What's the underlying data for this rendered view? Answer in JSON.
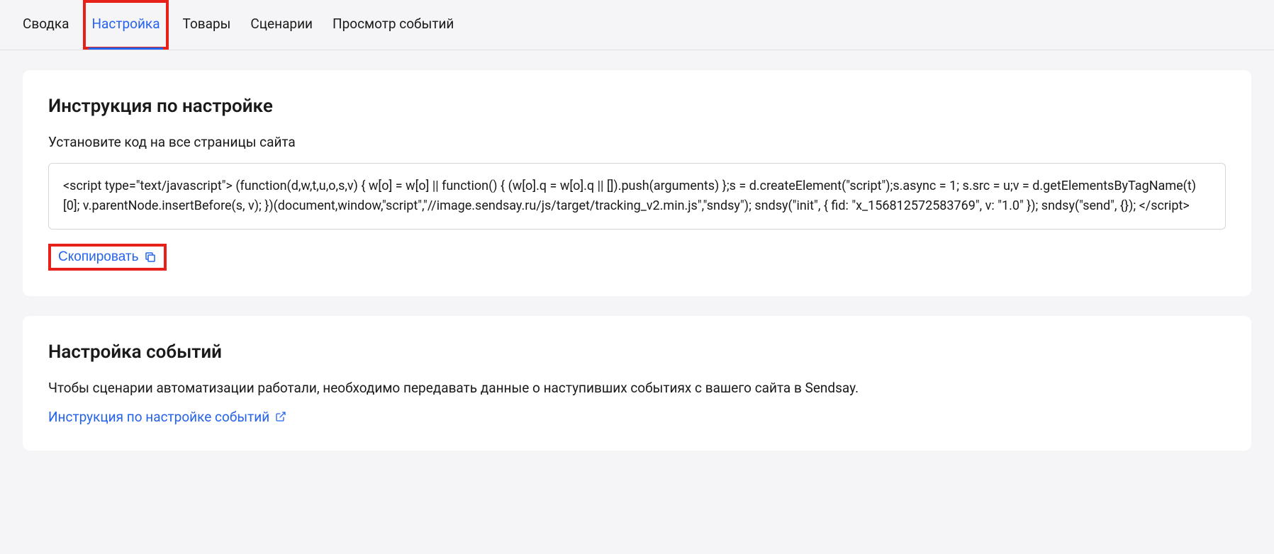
{
  "tabs": [
    {
      "label": "Сводка",
      "active": false
    },
    {
      "label": "Настройка",
      "active": true
    },
    {
      "label": "Товары",
      "active": false
    },
    {
      "label": "Сценарии",
      "active": false
    },
    {
      "label": "Просмотр событий",
      "active": false
    }
  ],
  "instruction_card": {
    "title": "Инструкция по настройке",
    "subtitle": "Установите код на все страницы сайта",
    "code": "<script type=\"text/javascript\"> (function(d,w,t,u,o,s,v) { w[o] = w[o] || function() { (w[o].q = w[o].q || []).push(arguments) };s = d.createElement(\"script\");s.async = 1; s.src = u;v = d.getElementsByTagName(t)[0]; v.parentNode.insertBefore(s, v); })(document,window,\"script\",\"//image.sendsay.ru/js/target/tracking_v2.min.js\",\"sndsy\"); sndsy(\"init\", { fid: \"x_156812572583769\", v: \"1.0\" }); sndsy(\"send\", {}); </script>",
    "copy_label": "Скопировать"
  },
  "events_card": {
    "title": "Настройка событий",
    "description": "Чтобы сценарии автоматизации работали, необходимо передавать данные о наступивших событиях с вашего сайта в Sendsay.",
    "link_label": "Инструкция по настройке событий"
  }
}
